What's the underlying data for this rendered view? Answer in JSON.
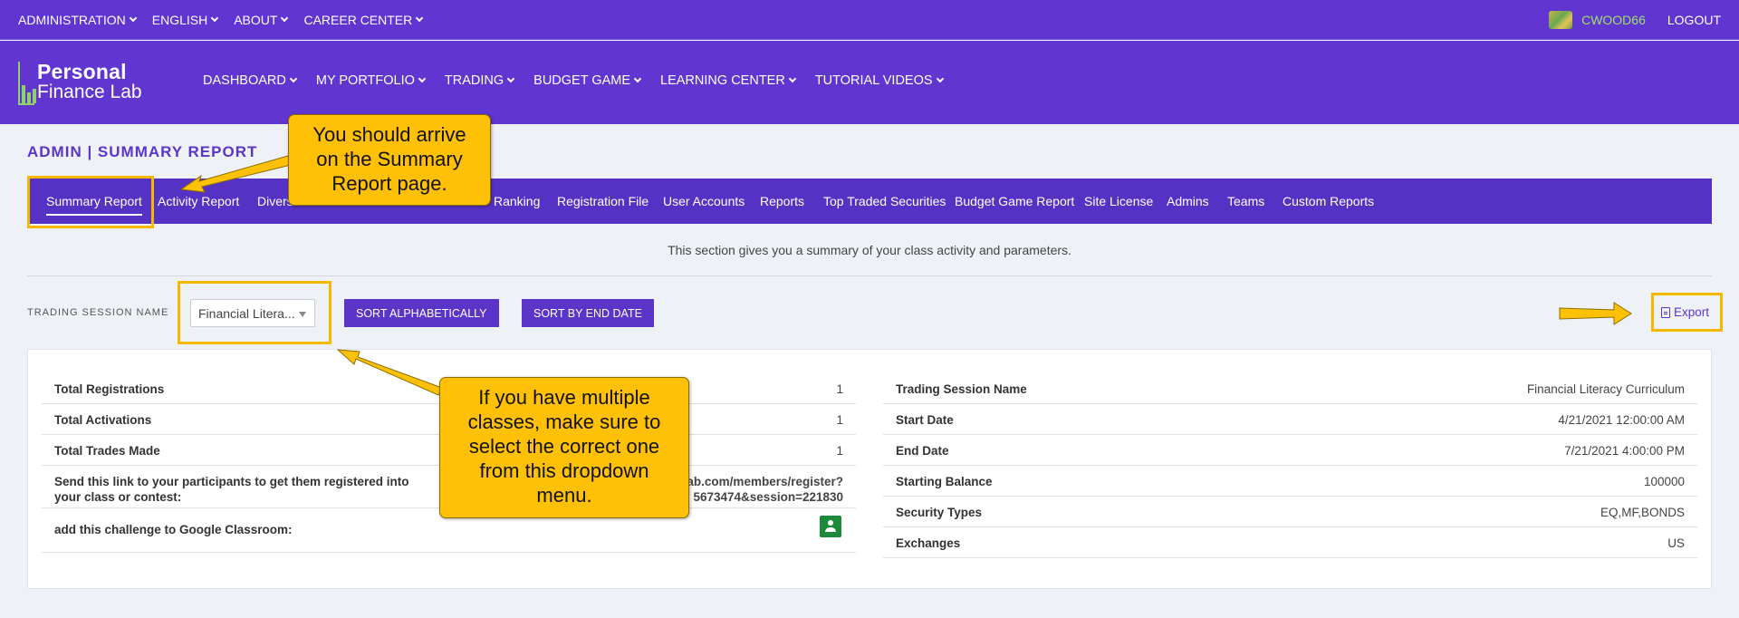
{
  "topbar": {
    "menu": [
      "ADMINISTRATION",
      "ENGLISH",
      "ABOUT",
      "CAREER CENTER"
    ],
    "username": "CWOOD66",
    "logout": "LOGOUT"
  },
  "logo": {
    "line1": "Personal",
    "line2": "Finance Lab"
  },
  "main_nav": [
    "DASHBOARD",
    "MY PORTFOLIO",
    "TRADING",
    "BUDGET GAME",
    "LEARNING CENTER",
    "TUTORIAL VIDEOS"
  ],
  "page_title": "ADMIN | SUMMARY REPORT",
  "subnav": {
    "items": [
      "Summary Report",
      "Activity Report",
      "Divers",
      "Ranking",
      "Registration File",
      "User Accounts",
      "Reports",
      "Top Traded Securities",
      "Budget Game Report",
      "Site License",
      "Admins",
      "Teams",
      "Custom Reports"
    ],
    "active": "Summary Report"
  },
  "description": "This section gives you a summary of your class activity and parameters.",
  "filter": {
    "label": "TRADING SESSION NAME",
    "selected": "Financial Litera...",
    "sort_alpha": "SORT ALPHABETICALLY",
    "sort_date": "SORT BY END DATE",
    "export": "Export"
  },
  "left_table": {
    "total_registrations": {
      "label": "Total Registrations",
      "value": "1"
    },
    "total_activations": {
      "label": "Total Activations",
      "value": "1"
    },
    "total_trades": {
      "label": "Total Trades Made",
      "value": "1"
    },
    "send_link": {
      "label_line1": "Send this link to your participants to get them registered into",
      "label_line2": "your class or contest:",
      "link_line1": "lab.com/members/register?",
      "link_line2": "5673474&session=221830"
    },
    "google_classroom": {
      "label": "add this challenge to Google Classroom:"
    }
  },
  "right_table": {
    "session_name": {
      "label": "Trading Session Name",
      "value": "Financial Literacy Curriculum"
    },
    "start_date": {
      "label": "Start Date",
      "value": "4/21/2021 12:00:00 AM"
    },
    "end_date": {
      "label": "End Date",
      "value": "7/21/2021 4:00:00 PM"
    },
    "starting_balance": {
      "label": "Starting Balance",
      "value": "100000"
    },
    "security_types": {
      "label": "Security Types",
      "value": "EQ,MF,BONDS"
    },
    "exchanges": {
      "label": "Exchanges",
      "value": "US"
    }
  },
  "annotations": {
    "callout_top": {
      "line1": "You should arrive",
      "line2": "on the Summary",
      "line3": "Report page."
    },
    "callout_bottom": {
      "line1": "If you have multiple",
      "line2": "classes, make sure to",
      "line3": "select the correct one",
      "line4": "from this dropdown",
      "line5": "menu."
    }
  },
  "colors": {
    "brand_purple": "#6035d0",
    "subnav_purple": "#5532c4",
    "highlight": "#f5b800",
    "callout": "#ffc107"
  }
}
